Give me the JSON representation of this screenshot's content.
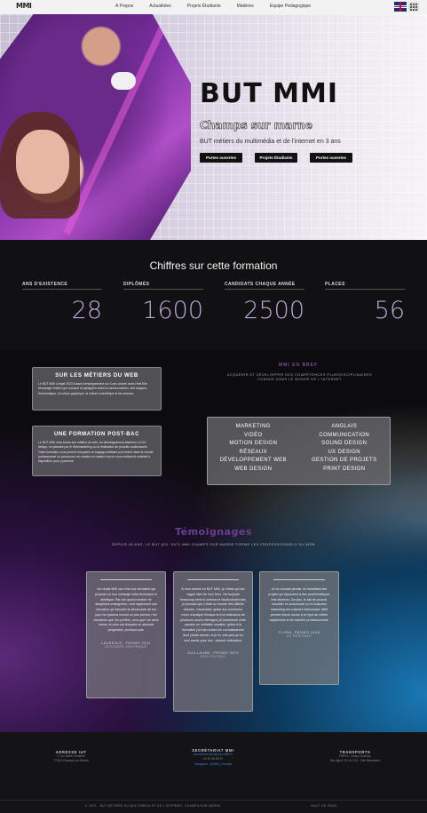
{
  "nav": {
    "logo": "MMI",
    "links": [
      "A Propos",
      "Actualitées",
      "Projets Étudiants",
      "Matières",
      "Equipe Pedagogique"
    ]
  },
  "hero": {
    "title": "BUT MMI",
    "subtitle": "Champs sur marne",
    "description": "BUT métiers du multimédia et de l'internet en 3 ans",
    "buttons": [
      "Portes ouvertes",
      "Projets Étudiants",
      "Portes ouvertes"
    ]
  },
  "stats": {
    "title": "Chiffres sur cette formation",
    "items": [
      {
        "label": "ANS D'EXISTENCE",
        "value": "28"
      },
      {
        "label": "DIPLÔMÉS",
        "value": "1600"
      },
      {
        "label": "CANDIDATS CHAQUE ANNÉE",
        "value": "2500"
      },
      {
        "label": "PLACES",
        "value": "56"
      }
    ]
  },
  "cards": [
    {
      "title": "SUR LES MÉTIERS DU WEB",
      "text": "Le BUT MMI a trajet 2023 Autant d'enseignement sur 3 ans ancrés dans l'énit Elle démarage entière que sauvant et partagées entre la communication, des langues, l'informatique, la culture graphique, la culture scientifique et les réseaux."
    },
    {
      "title": "UNE FORMATION POST-BAC",
      "text": "Le BUT MMI vous forme aux métiers du web, du développement backend, à l'UX design, en passant par le Webmarketing ou la réalisation de produits audiovisuels. Cette formation vous permet d'acquérir un bagage suffisant pour entrer dans le monde professionnel ou poursuivre vos études en master tout en vous mettant le matériel à disposition pour y parvenir."
    }
  ],
  "mmi": {
    "title": "MMI EN BREF",
    "description": "ACQUÉRIR ET DÉVELOPPER DES COMPÉTENCES PLURIDISCIPLINAIRES CONNUE DANS LE MONDE DE L'INTERNET",
    "skills_left": [
      "MARKETING",
      "VIDÉO",
      "MOTION DESIGN",
      "RÉSEAUX",
      "DÉVELOPPEMENT WEB",
      "WEB DESIGN"
    ],
    "skills_right": [
      "ANGLAIS",
      "COMMUNICATION",
      "SOUND DESIGN",
      "UX DESIGN",
      "GESTION DE PROJETS",
      "PRINT DESIGN"
    ]
  },
  "testimonials": {
    "title": "Témoignages",
    "subtitle": "DEPUIS 28 ANS, LE BUT (EX. DUT) MMI CHAMPS SUR MARNE FORME LES PROFESSIONNELS DU WEB",
    "items": [
      {
        "text": "J'ai choisi MMI car c'est une formation qui propose un bon mélange entre technique et artistique. Par son grand nombre de disciplines enseignées, c'est également une formation qui favorise la découverte de soi pour les lycéens encore un peu perdus ! les domaines que l'on préfère, ceux que l'on aime moins, et ceux sur lesquels on aimerait progresser, pourquoi pas.",
        "author": "LAURENCE, PROMO 2021",
        "role": "DESIGNER GRAPHIQUE"
      },
      {
        "text": "À mon arrivée en BUT MMI, je n'étais qu'une vague idée de mon futur. J'ai toujours beaucoup aimé le cinéma et l'audiovisuel mais je pensais que c'était un monde très difficile d'accès. Cependant, grâce aux nombreux cours d'analyse filmique et à la réalisation de plusieurs courts-métrages j'ai transformé cette passion en véritable vocation, grâce à la formation j'ai reçu toutes les connaissances dont j'avais besoin, et je ne vois plus qu'un seul avenir pour moi : devenir réalisateur.",
        "author": "GUILLAUME, PROMO 2019",
        "role": "RÉALISATEUR"
      },
      {
        "text": "Je ne connais jamais, en travaillant des projets qui répondent à des problématiques très diverses. De plus, le fait de pouvoir travailler en autonomie ou en business marketing est vraiment intéressant. MMI permet d'avoir accès à ce type de métier rapidement et de manière professionnelle.",
        "author": "FLORA, PROMO 2018",
        "role": "UX DESIGNER"
      }
    ]
  },
  "footer": {
    "col1_title": "ADRESSE IUT",
    "col1_lines": [
      "2, rue Albert Einstein",
      "77420 Champs-sur-Marne"
    ],
    "col2_title": "SECRÉTARIAT MMI",
    "col2_lines": [
      "secretariat.mmi@univ-eiffel.fr",
      "01 60 95 85 37",
      "Instagram : @MMI_Champs"
    ],
    "col3_title": "TRANSPORTS",
    "col3_lines": [
      "RER A - Noisy-Champs",
      "Bus ligne 212 et 213 : Cité Descartes"
    ],
    "copyright": "© 2023 - BUT MÉTIERS DU MULTIMÉDIA ET DE L'INTERNET, CHAMPS-SUR-MARNE",
    "back_to_top": "HAUT DE PAGE"
  }
}
